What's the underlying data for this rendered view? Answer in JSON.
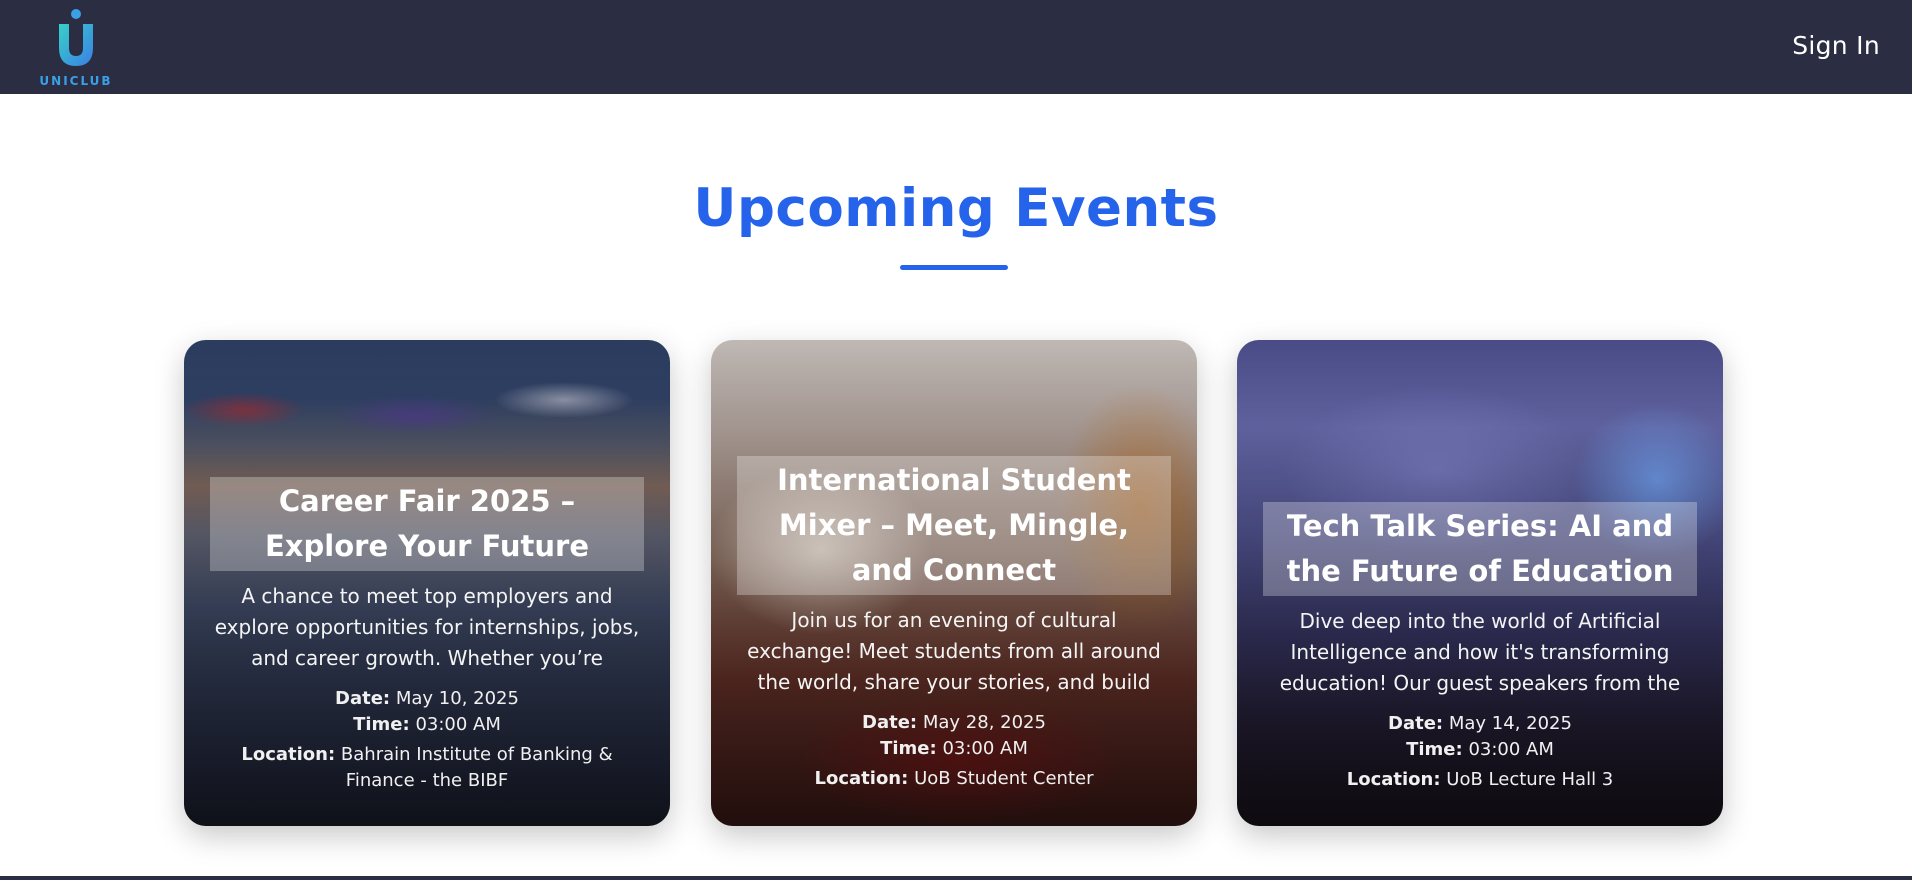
{
  "header": {
    "logo_text": "UNICLUB",
    "signin_label": "Sign In"
  },
  "section": {
    "title": "Upcoming Events"
  },
  "events": [
    {
      "title": "Career Fair 2025 – Explore Your Future",
      "description": "A chance to meet top employers and explore opportunities for internships, jobs, and career growth. Whether you’re",
      "date_label": "Date:",
      "date": "May 10, 2025",
      "time_label": "Time:",
      "time": "03:00 AM",
      "location_label": "Location:",
      "location": "Bahrain Institute of Banking & Finance - the BIBF"
    },
    {
      "title": "International Student Mixer – Meet, Mingle, and Connect",
      "description": "Join us for an evening of cultural exchange! Meet students from all around the world, share your stories, and build",
      "date_label": "Date:",
      "date": "May 28, 2025",
      "time_label": "Time:",
      "time": "03:00 AM",
      "location_label": "Location:",
      "location": "UoB Student Center"
    },
    {
      "title": "Tech Talk Series: AI and the Future of Education",
      "description": "Dive deep into the world of Artificial Intelligence and how it's transforming education! Our guest speakers from the",
      "date_label": "Date:",
      "date": "May 14, 2025",
      "time_label": "Time:",
      "time": "03:00 AM",
      "location_label": "Location:",
      "location": "UoB Lecture Hall 3"
    }
  ],
  "colors": {
    "header_bg": "#2b2d42",
    "accent": "#2563eb",
    "logo_gradient": [
      "#3aa0e6",
      "#38d0c8"
    ]
  },
  "icons": {
    "logo": "uniclub-logo-icon"
  }
}
